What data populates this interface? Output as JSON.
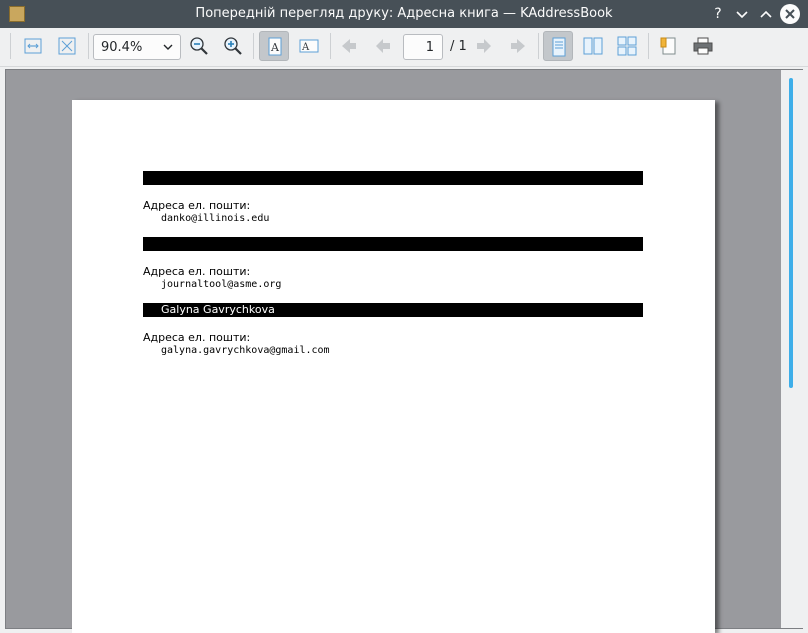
{
  "window": {
    "title": "Попередній перегляд друку: Адресна книга — KAddressBook",
    "controls": {
      "help": "?",
      "minimize": "⌄",
      "maximize": "⌃"
    }
  },
  "toolbar": {
    "zoom_value": "90.4%",
    "page_current": "1",
    "page_total": "/ 1"
  },
  "document": {
    "entries": [
      {
        "name": "",
        "email_label": "Адреса ел. пошти:",
        "email": "danko@illinois.edu"
      },
      {
        "name": "",
        "email_label": "Адреса ел. пошти:",
        "email": "journaltool@asme.org"
      },
      {
        "name": "Galyna Gavrychkova",
        "email_label": "Адреса ел. пошти:",
        "email": "galyna.gavrychkova@gmail.com"
      }
    ]
  },
  "colors": {
    "titlebar": "#475057",
    "accent": "#3daee9",
    "viewport_bg": "#999a9e"
  }
}
